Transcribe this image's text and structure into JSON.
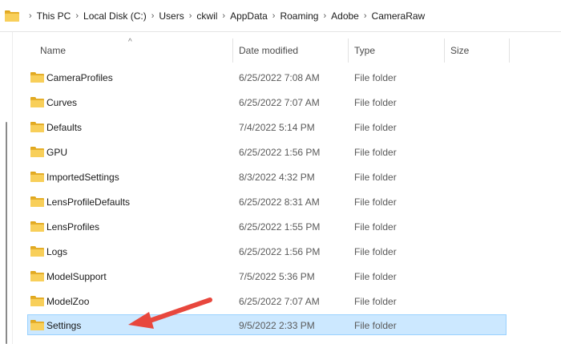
{
  "breadcrumb": [
    "This PC",
    "Local Disk (C:)",
    "Users",
    "ckwil",
    "AppData",
    "Roaming",
    "Adobe",
    "CameraRaw"
  ],
  "breadcrumb_separator": "›",
  "sort_indicator": "^",
  "columns": {
    "name": "Name",
    "date": "Date modified",
    "type": "Type",
    "size": "Size"
  },
  "rows": [
    {
      "name": "CameraProfiles",
      "date": "6/25/2022 7:08 AM",
      "type": "File folder"
    },
    {
      "name": "Curves",
      "date": "6/25/2022 7:07 AM",
      "type": "File folder"
    },
    {
      "name": "Defaults",
      "date": "7/4/2022 5:14 PM",
      "type": "File folder"
    },
    {
      "name": "GPU",
      "date": "6/25/2022 1:56 PM",
      "type": "File folder"
    },
    {
      "name": "ImportedSettings",
      "date": "8/3/2022 4:32 PM",
      "type": "File folder"
    },
    {
      "name": "LensProfileDefaults",
      "date": "6/25/2022 8:31 AM",
      "type": "File folder"
    },
    {
      "name": "LensProfiles",
      "date": "6/25/2022 1:55 PM",
      "type": "File folder"
    },
    {
      "name": "Logs",
      "date": "6/25/2022 1:56 PM",
      "type": "File folder"
    },
    {
      "name": "ModelSupport",
      "date": "7/5/2022 5:36 PM",
      "type": "File folder"
    },
    {
      "name": "ModelZoo",
      "date": "6/25/2022 7:07 AM",
      "type": "File folder"
    },
    {
      "name": "Settings",
      "date": "9/5/2022 2:33 PM",
      "type": "File folder"
    }
  ],
  "selected_row": "Settings",
  "colors": {
    "folder": "#f8cf5a",
    "selection": "#cce8ff",
    "selection_border": "#99d1ff",
    "annotation_arrow": "#e8473d"
  }
}
